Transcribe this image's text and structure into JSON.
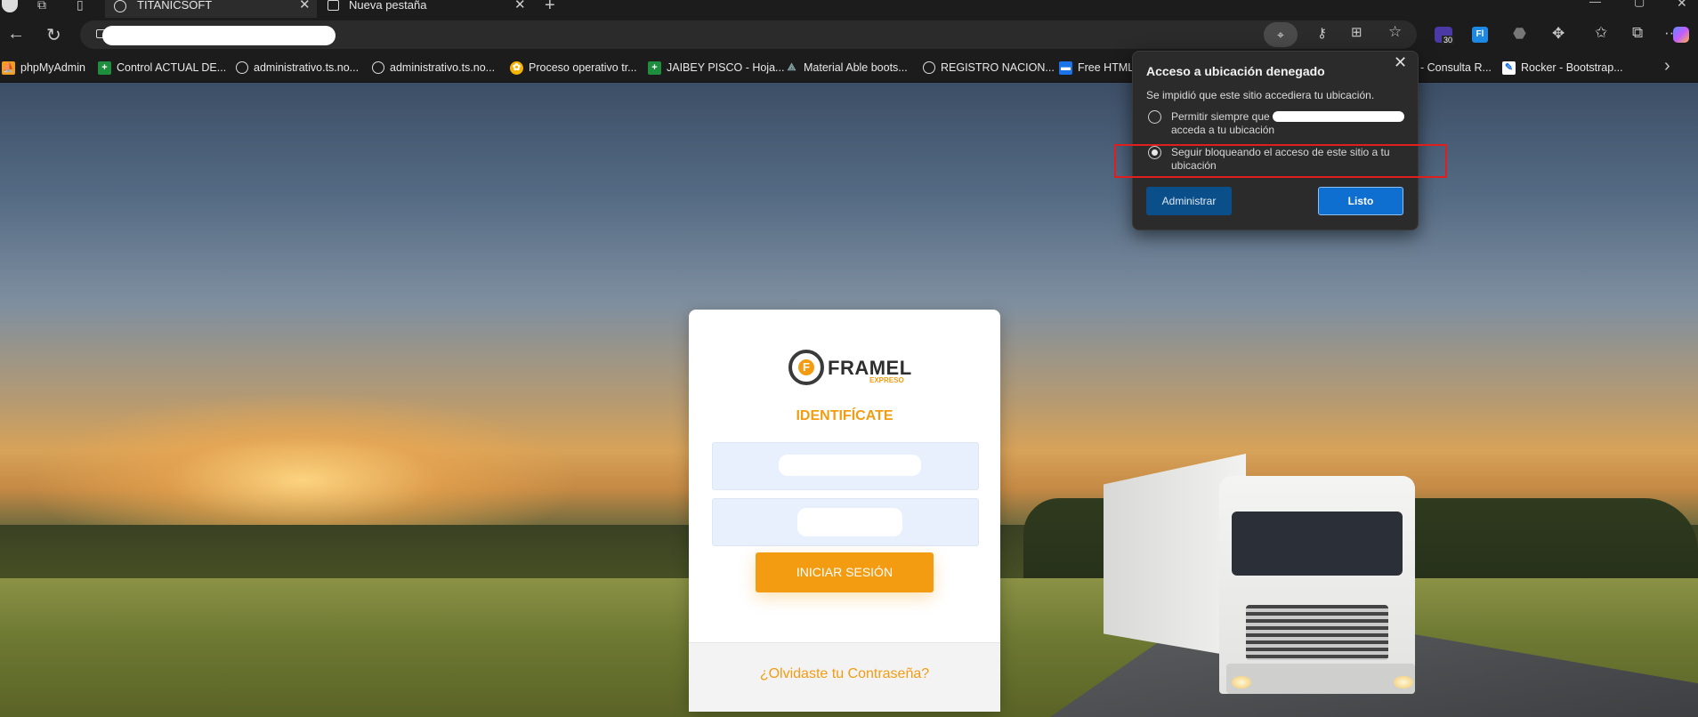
{
  "browser": {
    "tabs": [
      {
        "label": "TITANICSOFT",
        "active": true
      },
      {
        "label": "Nueva pestaña",
        "active": false
      }
    ],
    "new_tab": "+",
    "window_controls": {
      "minimize": "—",
      "maximize": "▢",
      "close": "✕"
    },
    "extension_badge": "30",
    "more_menu": "···"
  },
  "bookmarks": [
    {
      "label": "phpMyAdmin",
      "icon": "phpmyadmin-icon"
    },
    {
      "label": "Control ACTUAL DE...",
      "icon": "sheets-icon"
    },
    {
      "label": "administrativo.ts.no...",
      "icon": "globe-icon"
    },
    {
      "label": "administrativo.ts.no...",
      "icon": "globe-icon"
    },
    {
      "label": "Proceso operativo tr...",
      "icon": "process-icon"
    },
    {
      "label": "JAIBEY PISCO - Hoja...",
      "icon": "sheets-icon"
    },
    {
      "label": "Material Able boots...",
      "icon": "material-icon"
    },
    {
      "label": "REGISTRO NACION...",
      "icon": "globe-icon"
    },
    {
      "label": "Free HTML",
      "icon": "html-icon"
    },
    {
      "label": "- Consulta R...",
      "icon": ""
    },
    {
      "label": "Rocker - Bootstrap...",
      "icon": "rocker-icon"
    }
  ],
  "bookmarks_more": "›",
  "popup": {
    "title": "Acceso a ubicación denegado",
    "message": "Se impidió que este sitio accediera tu ubicación.",
    "option_allow_prefix": "Permitir siempre que",
    "option_allow_suffix": "acceda a tu ubicación",
    "option_block_line1": "Seguir bloqueando el acceso de este sitio a tu",
    "option_block_line2": "ubicación",
    "selected": "block",
    "manage_label": "Administrar",
    "done_label": "Listo",
    "close": "✕"
  },
  "login": {
    "logo_text": "FRAMEL",
    "logo_subtext": "EXPRESO",
    "logo_mark": "F",
    "heading": "IDENTIFÍCATE",
    "submit_label": "INICIAR SESIÓN",
    "forgot_label": "¿Olvidaste tu Contraseña?"
  },
  "colors": {
    "accent": "#f39c12",
    "popup_bg": "#2b2b2b",
    "highlight_box": "#e01e1e",
    "primary_button": "#0e6fd1"
  }
}
